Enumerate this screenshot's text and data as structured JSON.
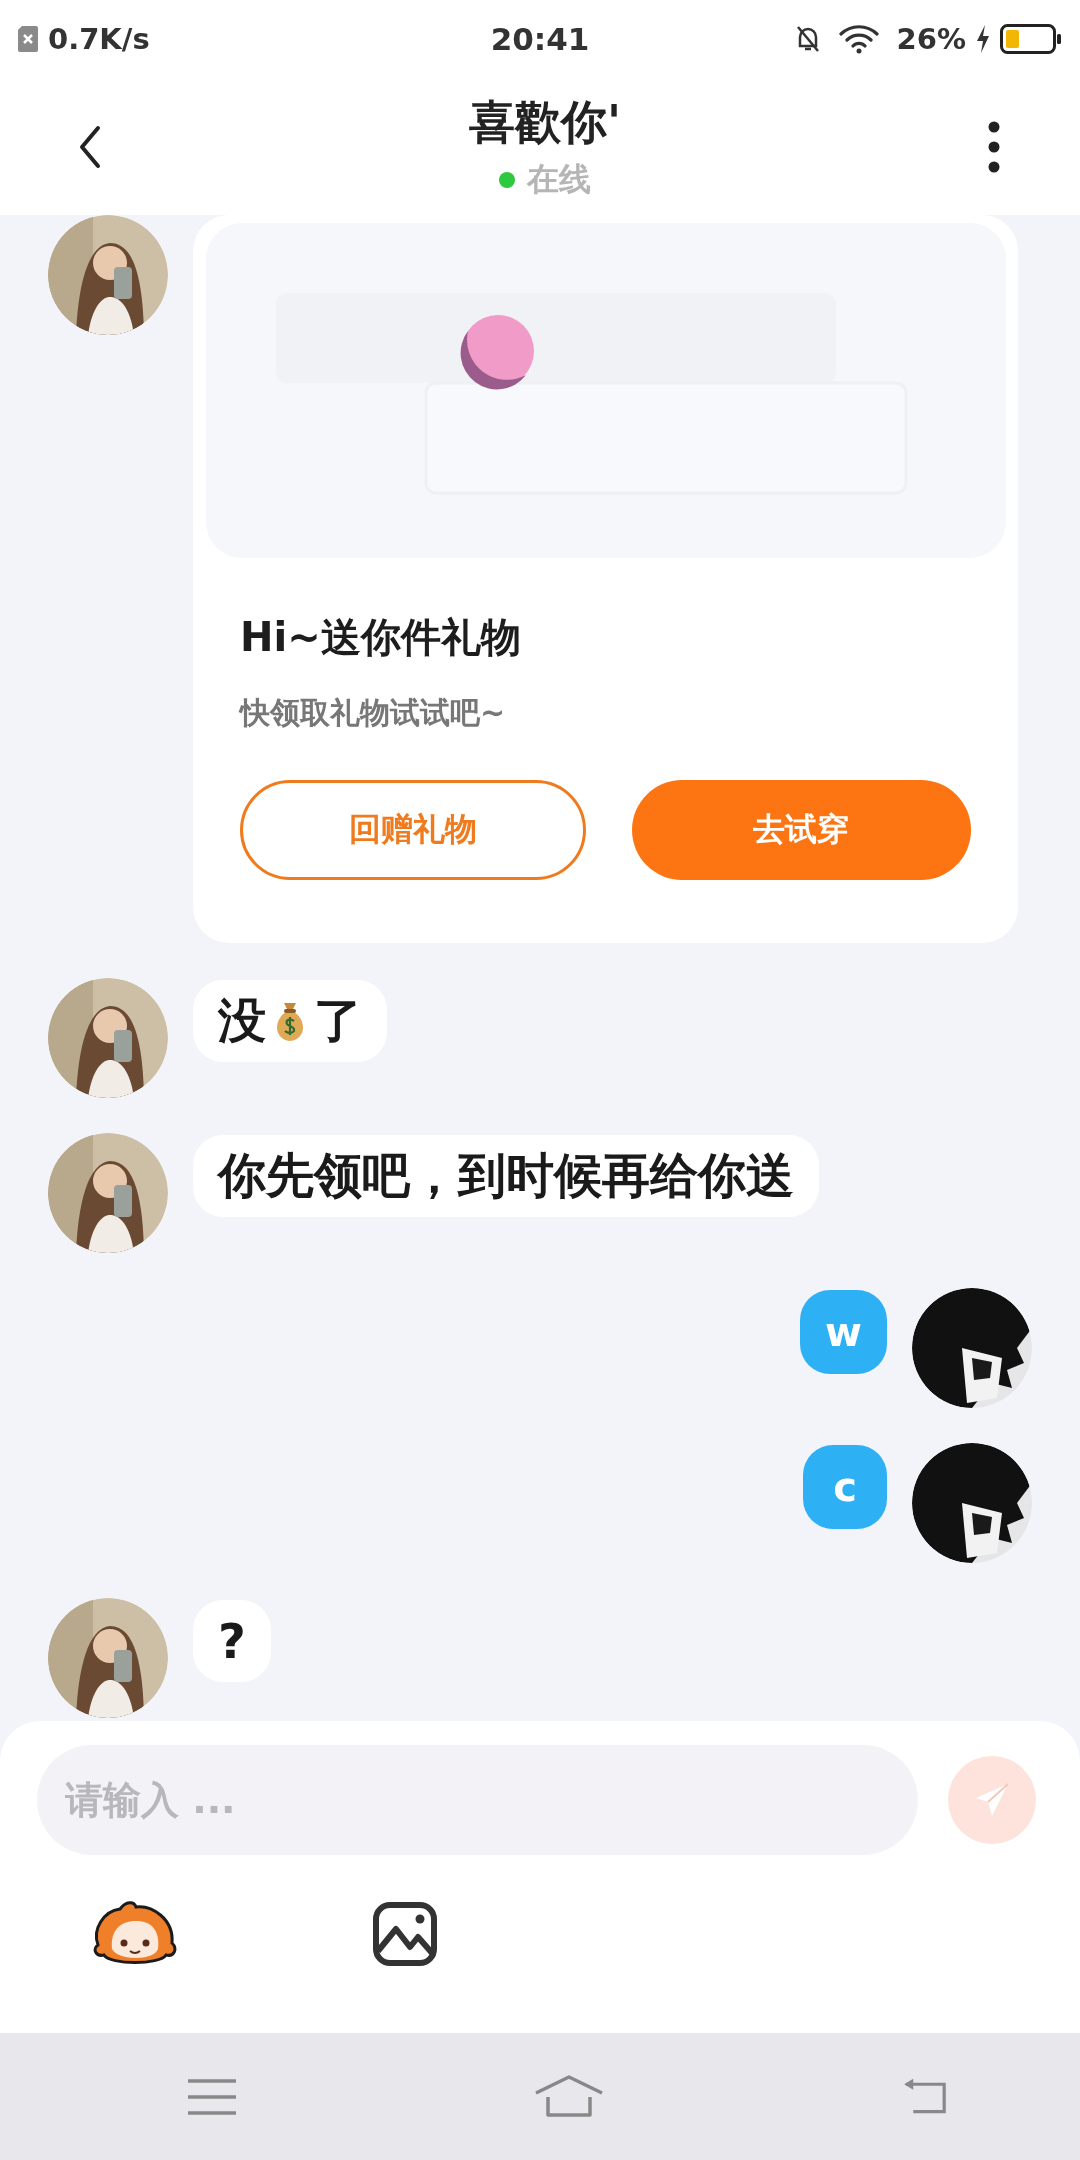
{
  "status_bar": {
    "speed": "0.7K/s",
    "time": "20:41",
    "battery": "26%"
  },
  "header": {
    "title": "喜歡你'",
    "online": true,
    "status": "在线"
  },
  "messages": [
    {
      "mine": false,
      "kind": "gift_card",
      "title": "Hi~送你件礼物",
      "subtitle": "快领取礼物试试吧~",
      "buttons": [
        {
          "label": "回赠礼物",
          "kind": "outline"
        },
        {
          "label": "去试穿",
          "kind": "filled"
        }
      ]
    },
    {
      "mine": false,
      "kind": "emoji_text",
      "before": "没",
      "after": "了"
    },
    {
      "mine": false,
      "kind": "text",
      "text": "你先领吧，到时候再给你送"
    },
    {
      "mine": true,
      "kind": "text",
      "text": "w"
    },
    {
      "mine": true,
      "kind": "text",
      "text": "c"
    },
    {
      "mine": false,
      "kind": "text",
      "text": "?"
    }
  ],
  "composer": {
    "placeholder": "请输入 ...",
    "send_disabled": true
  }
}
